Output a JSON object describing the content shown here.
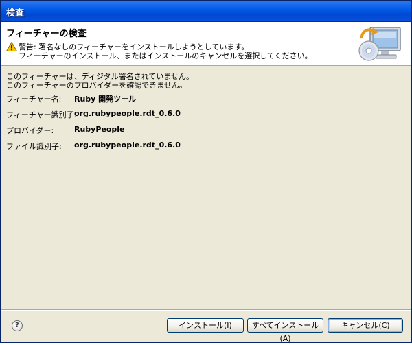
{
  "window": {
    "title": "検査"
  },
  "header": {
    "title": "フィーチャーの検査",
    "line1": "警告: 署名なしのフィーチャーをインストールしようとしています。",
    "line2": "フィーチャーのインストール、またはインストールのキャンセルを選択してください。",
    "warning_icon": "warning-icon",
    "banner_icon": "install-computer-cd-icon"
  },
  "body": {
    "message_line1": "このフィーチャーは、ディジタル署名されていません。",
    "message_line2": "このフィーチャーのプロバイダーを確認できません。",
    "fields": [
      {
        "label": "フィーチャー名:",
        "value": "Ruby 開発ツール"
      },
      {
        "label": "フィーチャー識別子:",
        "value": "org.rubypeople.rdt_0.6.0"
      },
      {
        "label": "プロバイダー:",
        "value": "RubyPeople"
      },
      {
        "label": "ファイル識別子:",
        "value": "org.rubypeople.rdt_0.6.0"
      }
    ]
  },
  "footer": {
    "help_glyph": "?",
    "install_label": "インストール(I)",
    "install_all_label": "すべてインストール(A)",
    "cancel_label": "キャンセル(C)"
  },
  "colors": {
    "titlebar": "#0058e6",
    "dialog_bg": "#ece9d8",
    "header_bg": "#ffffff"
  }
}
